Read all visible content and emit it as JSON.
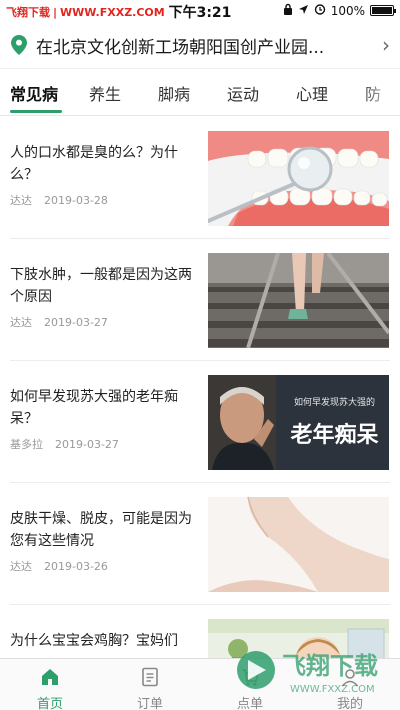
{
  "status_bar": {
    "carrier": "飞翔下载",
    "carrier_site": "WWW.FXXZ.COM",
    "time": "下午3:21",
    "battery": "100%",
    "battery_level": 1.0
  },
  "location": {
    "text": "在北京文化创新工场朝阳国创产业园...",
    "icon": "map-pin-icon",
    "chevron": "›"
  },
  "tabs": [
    {
      "label": "常见病",
      "active": true
    },
    {
      "label": "养生",
      "active": false
    },
    {
      "label": "脚病",
      "active": false
    },
    {
      "label": "运动",
      "active": false
    },
    {
      "label": "心理",
      "active": false
    },
    {
      "label": "防",
      "active": false
    }
  ],
  "articles": [
    {
      "title": "人的口水都是臭的么？为什么？",
      "author": "达达",
      "date": "2019-03-28"
    },
    {
      "title": "下肢水肿，一般都是因为这两个原因",
      "author": "达达",
      "date": "2019-03-27"
    },
    {
      "title": "如何早发现苏大强的老年痴呆？",
      "author": "基多拉",
      "date": "2019-03-27",
      "thumb_caption_small": "如何早发现苏大强的",
      "thumb_caption_big": "老年痴呆"
    },
    {
      "title": "皮肤干燥、脱皮，可能是因为您有这些情况",
      "author": "达达",
      "date": "2019-03-26"
    },
    {
      "title": "为什么宝宝会鸡胸？宝妈们"
    }
  ],
  "bottom_nav": [
    {
      "label": "首页",
      "icon": "home-icon",
      "active": true
    },
    {
      "label": "订单",
      "icon": "order-icon",
      "active": false
    },
    {
      "label": "点单",
      "icon": "cart-icon",
      "active": false
    },
    {
      "label": "我的",
      "icon": "user-icon",
      "active": false
    }
  ],
  "watermark": {
    "name": "飞翔下载",
    "site": "WWW.FXXZ.COM"
  },
  "colors": {
    "accent": "#2e9e6b",
    "carrier_red": "#e0261f"
  }
}
